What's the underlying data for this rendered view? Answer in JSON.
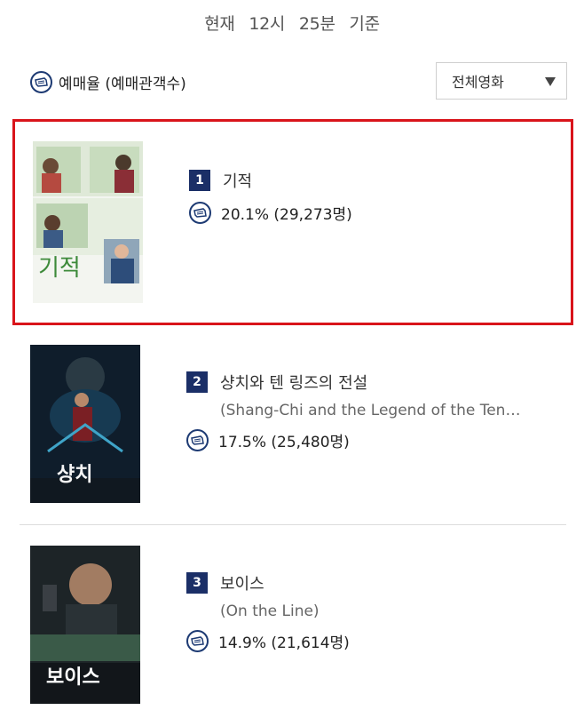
{
  "header": {
    "prefix": "현재",
    "time_hour": "12시",
    "time_min": "25분",
    "suffix": "기준"
  },
  "rate_label": "예매율 (예매관객수)",
  "filter": {
    "selected": "전체영화"
  },
  "movies": [
    {
      "rank": "1",
      "title": "기적",
      "subtitle": "",
      "rate": "20.1% (29,273명)",
      "poster_title": "기적"
    },
    {
      "rank": "2",
      "title": "샹치와 텐 링즈의 전설",
      "subtitle": "(Shang-Chi and the Legend of the Ten…",
      "rate": "17.5% (25,480명)",
      "poster_title": "샹치"
    },
    {
      "rank": "3",
      "title": "보이스",
      "subtitle": "(On the Line)",
      "rate": "14.9% (21,614명)",
      "poster_title": "보이스"
    }
  ],
  "colors": {
    "highlight_border": "#d9141b",
    "rank_badge": "#1b2f67"
  }
}
